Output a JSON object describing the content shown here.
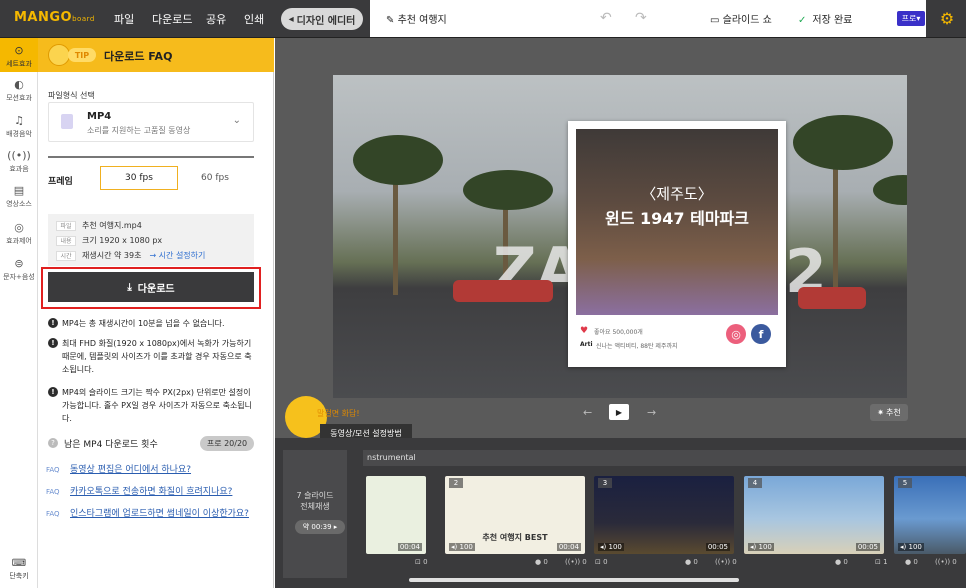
{
  "header": {
    "logo": "MANGO",
    "logo_sub": "board",
    "menus": [
      "파일",
      "다운로드",
      "공유",
      "인쇄"
    ],
    "editor_button": "디자인 에디터",
    "doc_title": "추천 여행지",
    "slideshow": "슬라이드 쇼",
    "saved": "저장 완료",
    "pro": "프로"
  },
  "iconbar": {
    "items": [
      "세트효과",
      "모션효과",
      "배경음악",
      "효과음",
      "영상소스",
      "효과제어",
      "문자+음성"
    ],
    "shortcut": "단축키"
  },
  "panel": {
    "tip": "TIP",
    "title": "다운로드 FAQ",
    "format_label": "파일형식 선택",
    "format_name": "MP4",
    "format_desc": "소리를 지원하는 고품질 동영상",
    "frame_label": "프레임",
    "fps_selected": "30 fps",
    "fps_other": "60 fps",
    "info": {
      "file_tag": "파일",
      "file_value": "추천 여행지.mp4",
      "size_tag": "내용",
      "size_value": "크기 1920 x 1080 px",
      "time_tag": "시간",
      "time_value": "재생시간 약 39초",
      "time_link": "→ 시간 설정하기"
    },
    "download_button": "다운로드",
    "notes": [
      "MP4는 총 재생시간이 10분을 넘을 수 없습니다.",
      "최대 FHD 화질(1920 x 1080px)에서 녹화가 가능하기 때문에, 템플릿의 사이즈가 이를 초과할 경우 자동으로 축소됩니다.",
      "MP4의 슬라이드 크기는 짝수 PX(2px) 단위로만 설정이 가능합니다. 홀수 PX일 경우 사이즈가 자동으로 축소됩니다."
    ],
    "remaining_label": "남은 MP4 다운로드 횟수",
    "remaining_badge": "프로 20/20",
    "faq_tag": "FAQ",
    "faqs": [
      "동영상 편집은 어디에서 하나요?",
      "카카오톡으로 전송하면 화질이 흐려지나요?",
      "인스타그램에 업로드하면 썸네일이 이상한가요?"
    ]
  },
  "canvas": {
    "card_line1": "〈제주도〉",
    "card_line2": "윈드 1947 테마파크",
    "likes": "좋아요 500,000개",
    "arti": "Arti",
    "arti_desc": "신나는 액티비티, 88탄 제주까지",
    "recommend": "추천",
    "mascot_say": "말걸면 화답!",
    "guide_tab": "동영상/모션 설정방법"
  },
  "timeline": {
    "audio": "nstrumental",
    "summary": "7 슬라이드\n전체재생",
    "summary_time": "약 00:39 ▸",
    "slides": [
      {
        "num": "",
        "dur": "00:04",
        "vol": "",
        "label": ""
      },
      {
        "num": "2",
        "dur": "00:04",
        "vol": "100",
        "label": "추천 여행지 BEST"
      },
      {
        "num": "3",
        "dur": "00:05",
        "vol": "100",
        "label": ""
      },
      {
        "num": "4",
        "dur": "00:05",
        "vol": "100",
        "label": ""
      },
      {
        "num": "5",
        "dur": "",
        "vol": "100",
        "label": ""
      }
    ],
    "ctrl": [
      "0",
      "0",
      "0",
      "0",
      "0",
      "0",
      "0",
      "1",
      "0",
      "0"
    ]
  }
}
